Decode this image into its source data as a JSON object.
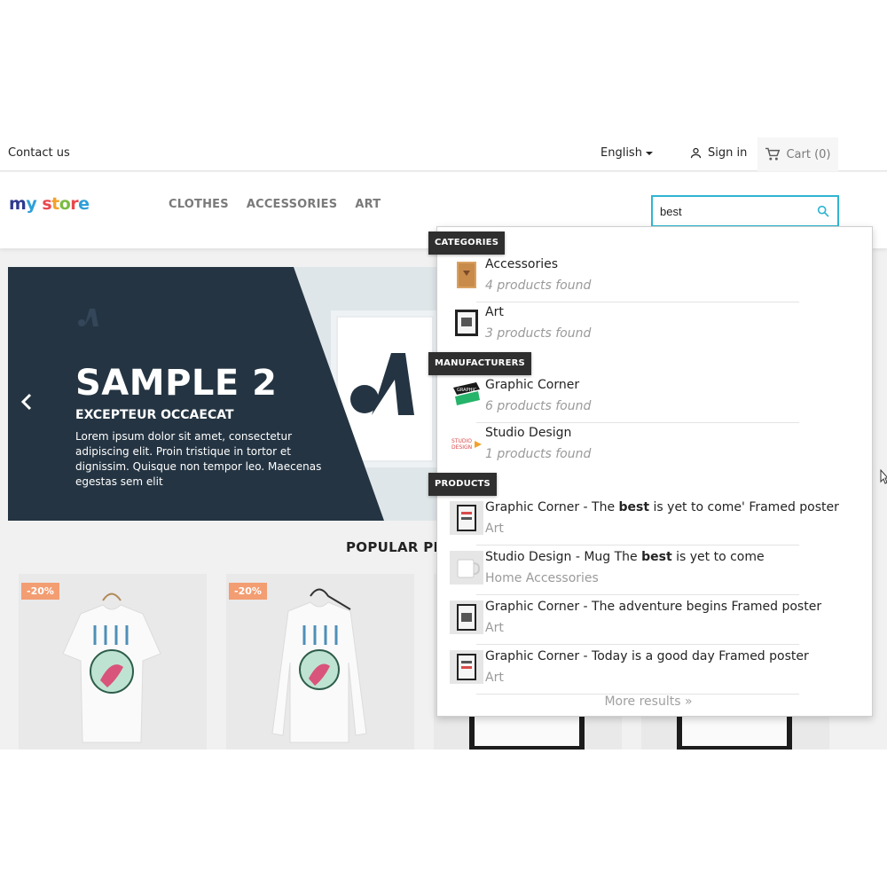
{
  "topnav": {
    "contact": "Contact us",
    "language": "English",
    "signin": "Sign in",
    "cart": "Cart (0)"
  },
  "header": {
    "logo": "my store",
    "menu": [
      "CLOTHES",
      "ACCESSORIES",
      "ART"
    ],
    "search_value": "best"
  },
  "slider": {
    "title": "SAMPLE 2",
    "subtitle": "EXCEPTEUR OCCAECAT",
    "text": "Lorem ipsum dolor sit amet, consectetur adipiscing elit. Proin tristique in tortor et dignissim. Quisque non tempor leo. Maecenas egestas sem elit"
  },
  "popular_heading": "POPULAR PR",
  "products": [
    {
      "badge": "-20%"
    },
    {
      "badge": "-20%"
    }
  ],
  "dropdown": {
    "categories_label": "CATEGORIES",
    "manufacturers_label": "MANUFACTURERS",
    "products_label": "PRODUCTS",
    "categories": [
      {
        "name": "Accessories",
        "meta": "4 products found"
      },
      {
        "name": "Art",
        "meta": "3 products found"
      }
    ],
    "manufacturers": [
      {
        "name": "Graphic Corner",
        "meta": "6 products found"
      },
      {
        "name": "Studio Design",
        "meta": "1 products found"
      }
    ],
    "products": [
      {
        "brand": "Graphic Corner",
        "pre": "The ",
        "highlight": "best",
        "post": " is yet to come' Framed poster",
        "category": "Art"
      },
      {
        "brand": "Studio Design",
        "pre": "Mug The ",
        "highlight": "best",
        "post": " is yet to come",
        "category": "Home Accessories"
      },
      {
        "brand": "Graphic Corner",
        "pre": "The adventure begins Framed poster",
        "highlight": "",
        "post": "",
        "category": "Art"
      },
      {
        "brand": "Graphic Corner",
        "pre": "Today is a good day Framed poster",
        "highlight": "",
        "post": "",
        "category": "Art"
      }
    ],
    "more_results": "More results »"
  },
  "colors": {
    "accent": "#2fb5d2",
    "slide_dark": "#243442",
    "badge": "#f39d72"
  }
}
